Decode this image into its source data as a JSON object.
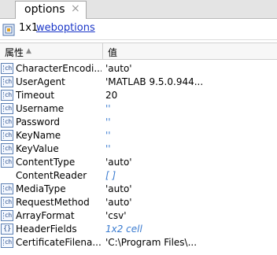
{
  "tab": {
    "label": "options",
    "close_glyph": "×"
  },
  "info": {
    "size": "1x1",
    "class_link": "weboptions",
    "icon": "struct-object-icon"
  },
  "header": {
    "name_col": "属性",
    "value_col": "值",
    "sort_arrow": "▲"
  },
  "rows": [
    {
      "name": "CharacterEncoding",
      "display_name": "CharacterEncodi...",
      "value": "'auto'",
      "kind": "char"
    },
    {
      "name": "UserAgent",
      "display_name": "UserAgent",
      "value": "'MATLAB 9.5.0.944...",
      "kind": "char"
    },
    {
      "name": "Timeout",
      "display_name": "Timeout",
      "value": "20",
      "kind": "char"
    },
    {
      "name": "Username",
      "display_name": "Username",
      "value": "''",
      "kind": "empty"
    },
    {
      "name": "Password",
      "display_name": "Password",
      "value": "''",
      "kind": "empty"
    },
    {
      "name": "KeyName",
      "display_name": "KeyName",
      "value": "''",
      "kind": "empty"
    },
    {
      "name": "KeyValue",
      "display_name": "KeyValue",
      "value": "''",
      "kind": "empty"
    },
    {
      "name": "ContentType",
      "display_name": "ContentType",
      "value": "'auto'",
      "kind": "char"
    },
    {
      "name": "ContentReader",
      "display_name": "ContentReader",
      "value": "[ ]",
      "kind": "empty-arr"
    },
    {
      "name": "MediaType",
      "display_name": "MediaType",
      "value": "'auto'",
      "kind": "char"
    },
    {
      "name": "RequestMethod",
      "display_name": "RequestMethod",
      "value": "'auto'",
      "kind": "char"
    },
    {
      "name": "ArrayFormat",
      "display_name": "ArrayFormat",
      "value": "'csv'",
      "kind": "char"
    },
    {
      "name": "HeaderFields",
      "display_name": "HeaderFields",
      "value": "1x2 cell",
      "kind": "cell"
    },
    {
      "name": "CertificateFilename",
      "display_name": "CertificateFilena...",
      "value": "'C:\\Program Files\\...",
      "kind": "char"
    }
  ],
  "colors": {
    "link": "#1a36c8",
    "muted_value": "#3a7bd0",
    "icon_border": "#5b7fb3"
  }
}
